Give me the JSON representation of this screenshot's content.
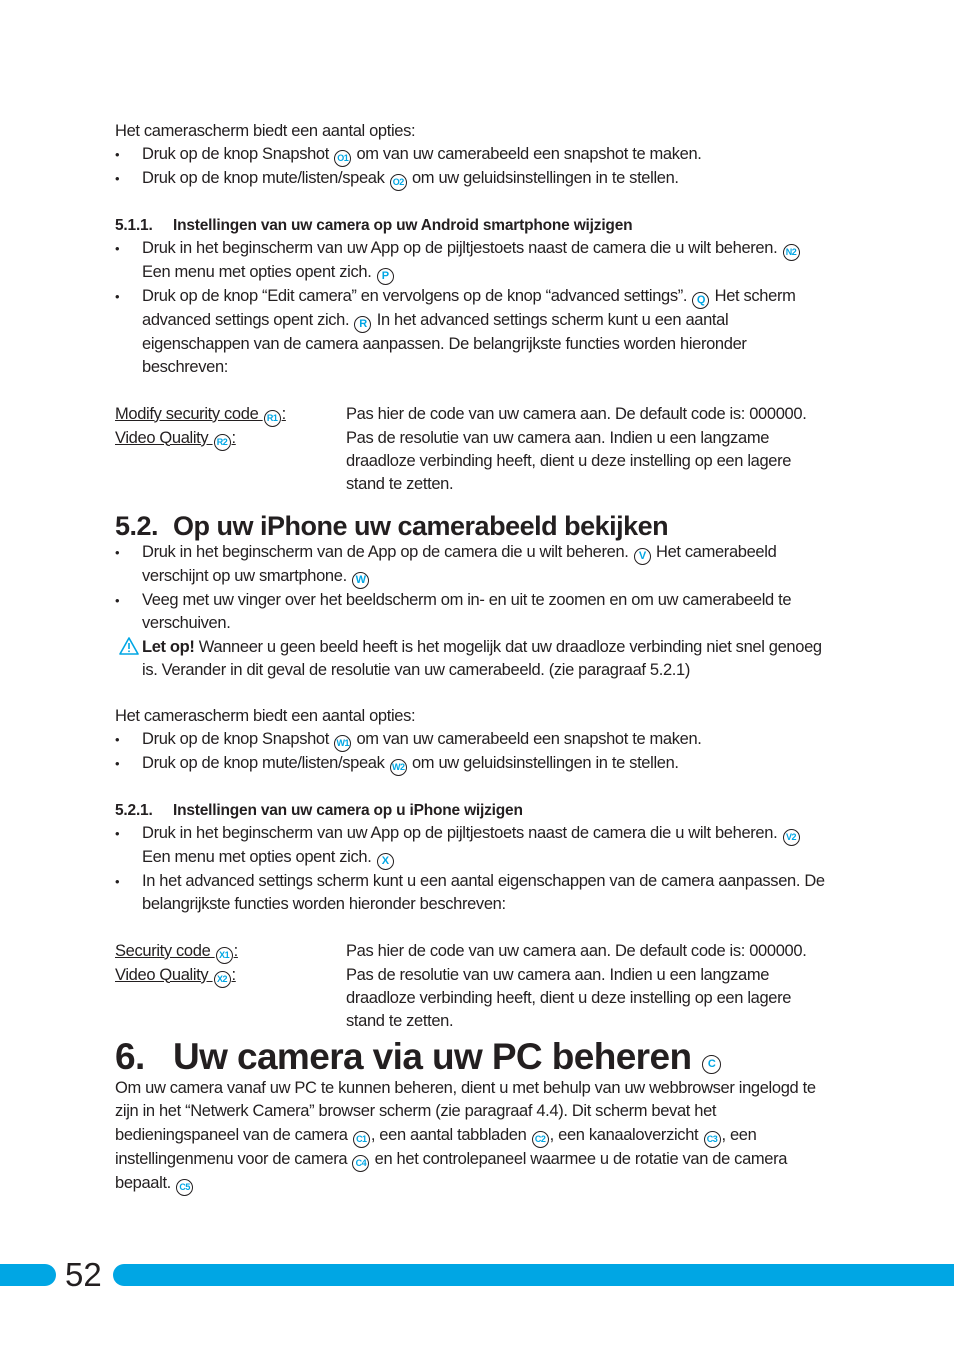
{
  "section_50_tail": {
    "intro": "Het camerascherm biedt een aantal opties:",
    "bullets": [
      {
        "before": "Druk op de knop Snapshot ",
        "badge": "O1",
        "after": " om van uw camerabeeld een snapshot te maken."
      },
      {
        "before": "Druk op de knop mute/listen/speak ",
        "badge": "O2",
        "after": " om uw geluidsinstellingen in te stellen."
      }
    ]
  },
  "section_511": {
    "number": "5.1.1.",
    "title": "Instellingen van uw camera op uw Android smartphone wijzigen",
    "bullet1": {
      "a": "Druk in het beginscherm van uw App op de pijltjestoets naast de camera die u wilt beheren. ",
      "badge1": "N2",
      "b": " Een menu met opties opent zich. ",
      "badge2": "P"
    },
    "bullet2": {
      "a": "Druk op de knop “Edit camera” en vervolgens op de knop “advanced settings”. ",
      "badge1": "Q",
      "b": " Het scherm advanced settings opent zich. ",
      "badge2": "R",
      "c": " In het advanced settings scherm kunt u een aantal eigenschappen van de camera aanpassen. De belangrijkste functies worden hieronder beschreven:"
    },
    "definitions": [
      {
        "term": "Modify security code ",
        "badge": "R1",
        "colon": ":",
        "desc": "Pas hier de code van uw camera aan. De default code is: 000000."
      },
      {
        "term": "Video Quality ",
        "badge": "R2",
        "colon": ":",
        "desc": "Pas de resolutie van uw camera aan. Indien u een langzame draadloze verbinding heeft, dient u deze instelling op een lagere stand te zetten."
      }
    ]
  },
  "section_52": {
    "number": "5.2.",
    "title": "Op uw iPhone uw camerabeeld bekijken",
    "bullet1": {
      "a": "Druk in het beginscherm van de App op de camera die u wilt beheren. ",
      "badge1": "V",
      "b": " Het camerabeeld verschijnt op uw smartphone. ",
      "badge2": "W"
    },
    "bullet2": "Veeg met uw vinger over het beeldscherm om in- en uit te zoomen en om uw camerabeeld te verschuiven.",
    "warning": {
      "icon": "warning-icon",
      "label": "Let op!",
      "text": " Wanneer u geen beeld heeft is het mogelijk dat uw draadloze verbinding niet snel genoeg is. Verander in dit geval de resolutie van uw camerabeeld.  (zie paragraaf 5.2.1)"
    },
    "intro": "Het camerascherm biedt een aantal opties:",
    "bullets": [
      {
        "before": "Druk op de knop Snapshot ",
        "badge": "W1",
        "after": " om van uw camerabeeld een snapshot te maken."
      },
      {
        "before": "Druk op de knop mute/listen/speak ",
        "badge": "W2",
        "after": " om uw geluidsinstellingen in te stellen."
      }
    ]
  },
  "section_521": {
    "number": "5.2.1.",
    "title": "Instellingen van uw camera op u iPhone wijzigen",
    "bullet1": {
      "a": "Druk in het beginscherm van uw App op de pijltjestoets naast de camera die u wilt beheren. ",
      "badge1": "V2",
      "b": " Een menu met opties opent zich. ",
      "badge2": "X"
    },
    "bullet2": "In het advanced settings scherm kunt u een aantal eigenschappen van de camera aanpassen. De belangrijkste functies worden hieronder beschreven:",
    "definitions": [
      {
        "term": "Security code ",
        "badge": "X1",
        "colon": ":",
        "desc": "Pas hier de code van uw camera aan. De default code is: 000000."
      },
      {
        "term": "Video Quality ",
        "badge": "X2",
        "colon": ":",
        "desc": "Pas de resolutie van uw camera aan. Indien u een langzame draadloze verbinding heeft, dient u deze instelling op een lagere stand te zetten."
      }
    ]
  },
  "section_6": {
    "number": "6.",
    "title": "Uw camera via uw PC beheren",
    "title_badge": "C",
    "p": {
      "a": "Om uw camera vanaf uw PC te kunnen beheren, dient u met behulp van uw webbrowser ingelogd te zijn in het “Netwerk Camera” browser scherm (zie paragraaf 4.4). Dit scherm bevat het bedieningspaneel van de camera ",
      "c1": "C1",
      "b": ", een aantal tabbladen ",
      "c2": "C2",
      "c": ", een kanaaloverzicht ",
      "c3": "C3",
      "d": ", een instellingenmenu voor de camera ",
      "c4": "C4",
      "e": " en het controlepaneel waarmee u de rotatie van de camera bepaalt. ",
      "c5": "C5"
    }
  },
  "footer": {
    "page_number": "52",
    "bar_color": "#00a6e4"
  }
}
